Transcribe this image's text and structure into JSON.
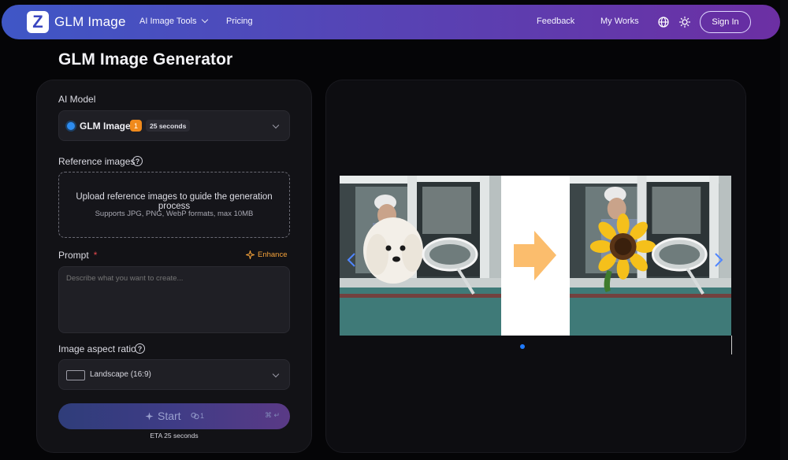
{
  "header": {
    "logo_letter": "Z",
    "brand": "GLM Image",
    "nav": {
      "tools": "AI Image Tools",
      "pricing": "Pricing",
      "feedback": "Feedback",
      "my_works": "My Works"
    },
    "sign_in": "Sign In"
  },
  "page": {
    "title": "GLM Image Generator"
  },
  "form": {
    "model_label": "AI Model",
    "model_name": "GLM Image",
    "model_badge": "1",
    "model_eta": "25 seconds",
    "reference_label": "Reference images",
    "upload_main": "Upload reference images to guide the generation process",
    "upload_sub": "Supports JPG, PNG, WebP formats, max 10MB",
    "prompt_label": "Prompt",
    "required_mark": "*",
    "enhance_label": "Enhance",
    "prompt_placeholder": "Describe what you want to create...",
    "aspect_label": "Image aspect ratio",
    "aspect_value": "Landscape (16:9)",
    "start_label": "Start",
    "start_credits": "1",
    "start_shortcut": "⌘ ↵",
    "eta": "ETA 25 seconds"
  },
  "colors": {
    "header_start": "#3f57c6",
    "header_end": "#6c2fa3",
    "accent_orange": "#f08a1c",
    "accent_blue": "#1f7bff",
    "required_red": "#e5484d"
  }
}
